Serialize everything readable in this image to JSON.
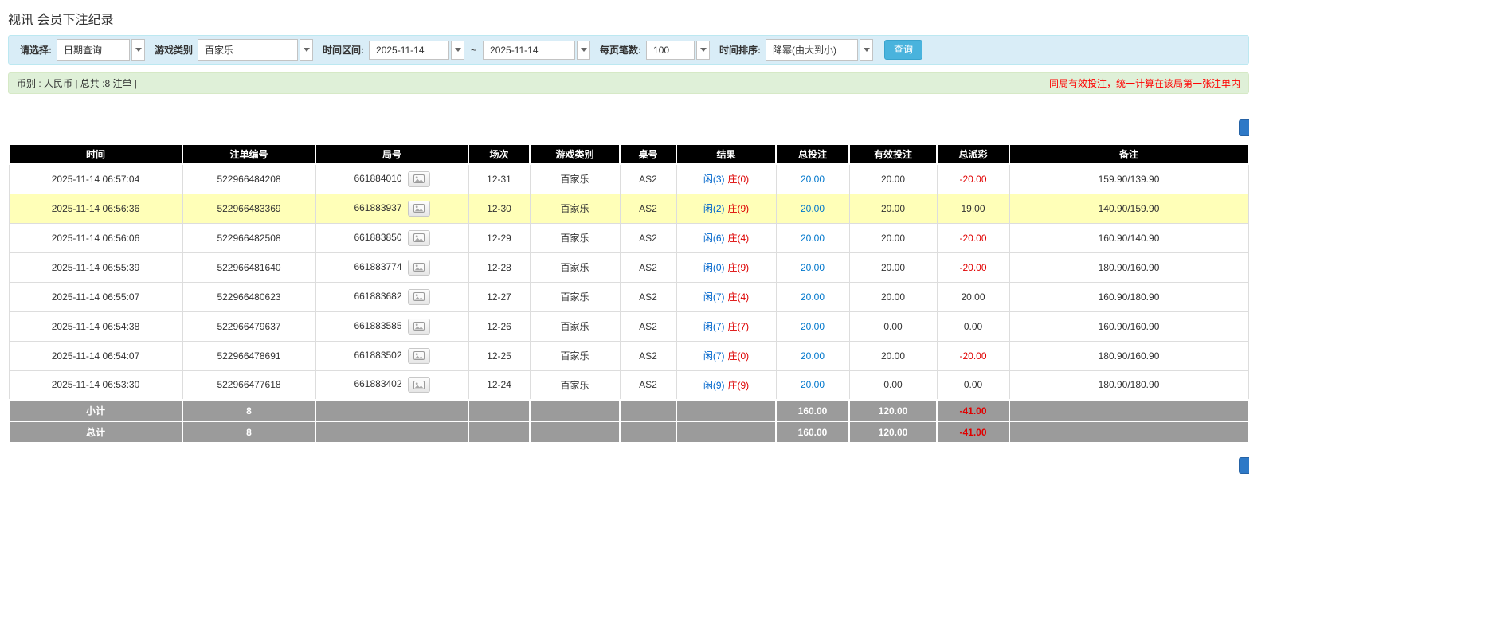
{
  "page": {
    "title": "视讯 会员下注纪录"
  },
  "filter_bar": {
    "select_label": "请选择:",
    "select_value": "日期查询",
    "game_type_label": "游戏类别",
    "game_type_value": "百家乐",
    "date_range_label": "时间区间:",
    "date_from": "2025-11-14",
    "date_separator": "~",
    "date_to": "2025-11-14",
    "page_size_label": "每页笔数:",
    "page_size_value": "100",
    "sort_label": "时间排序:",
    "sort_value": "降幂(由大到小)",
    "search_button_label": "查询"
  },
  "info_bar": {
    "summary": "币别 : 人民币 | 总共 :8 注单 |",
    "notice": "同局有效投注，统一计算在该局第一张注单内"
  },
  "table": {
    "headers": [
      "时间",
      "注单编号",
      "局号",
      "场次",
      "游戏类别",
      "桌号",
      "结果",
      "总投注",
      "有效投注",
      "总派彩",
      "备注"
    ],
    "rows": [
      {
        "time": "2025-11-14 06:57:04",
        "bet_id": "522966484208",
        "round_id": "661884010",
        "session": "12-31",
        "game": "百家乐",
        "table_no": "AS2",
        "result_player": "闲(3)",
        "result_banker": "庄(0)",
        "total_bet": "20.00",
        "valid_bet": "20.00",
        "payout": "-20.00",
        "note": "159.90/139.90",
        "highlight": false
      },
      {
        "time": "2025-11-14 06:56:36",
        "bet_id": "522966483369",
        "round_id": "661883937",
        "session": "12-30",
        "game": "百家乐",
        "table_no": "AS2",
        "result_player": "闲(2)",
        "result_banker": "庄(9)",
        "total_bet": "20.00",
        "valid_bet": "20.00",
        "payout": "19.00",
        "note": "140.90/159.90",
        "highlight": true
      },
      {
        "time": "2025-11-14 06:56:06",
        "bet_id": "522966482508",
        "round_id": "661883850",
        "session": "12-29",
        "game": "百家乐",
        "table_no": "AS2",
        "result_player": "闲(6)",
        "result_banker": "庄(4)",
        "total_bet": "20.00",
        "valid_bet": "20.00",
        "payout": "-20.00",
        "note": "160.90/140.90",
        "highlight": false
      },
      {
        "time": "2025-11-14 06:55:39",
        "bet_id": "522966481640",
        "round_id": "661883774",
        "session": "12-28",
        "game": "百家乐",
        "table_no": "AS2",
        "result_player": "闲(0)",
        "result_banker": "庄(9)",
        "total_bet": "20.00",
        "valid_bet": "20.00",
        "payout": "-20.00",
        "note": "180.90/160.90",
        "highlight": false
      },
      {
        "time": "2025-11-14 06:55:07",
        "bet_id": "522966480623",
        "round_id": "661883682",
        "session": "12-27",
        "game": "百家乐",
        "table_no": "AS2",
        "result_player": "闲(7)",
        "result_banker": "庄(4)",
        "total_bet": "20.00",
        "valid_bet": "20.00",
        "payout": "20.00",
        "note": "160.90/180.90",
        "highlight": false
      },
      {
        "time": "2025-11-14 06:54:38",
        "bet_id": "522966479637",
        "round_id": "661883585",
        "session": "12-26",
        "game": "百家乐",
        "table_no": "AS2",
        "result_player": "闲(7)",
        "result_banker": "庄(7)",
        "total_bet": "20.00",
        "valid_bet": "0.00",
        "payout": "0.00",
        "note": "160.90/160.90",
        "highlight": false
      },
      {
        "time": "2025-11-14 06:54:07",
        "bet_id": "522966478691",
        "round_id": "661883502",
        "session": "12-25",
        "game": "百家乐",
        "table_no": "AS2",
        "result_player": "闲(7)",
        "result_banker": "庄(0)",
        "total_bet": "20.00",
        "valid_bet": "20.00",
        "payout": "-20.00",
        "note": "180.90/160.90",
        "highlight": false
      },
      {
        "time": "2025-11-14 06:53:30",
        "bet_id": "522966477618",
        "round_id": "661883402",
        "session": "12-24",
        "game": "百家乐",
        "table_no": "AS2",
        "result_player": "闲(9)",
        "result_banker": "庄(9)",
        "total_bet": "20.00",
        "valid_bet": "0.00",
        "payout": "0.00",
        "note": "180.90/180.90",
        "highlight": false
      }
    ],
    "subtotal": {
      "label": "小计",
      "count": "8",
      "total_bet": "160.00",
      "valid_bet": "120.00",
      "payout": "-41.00"
    },
    "total": {
      "label": "总计",
      "count": "8",
      "total_bet": "160.00",
      "valid_bet": "120.00",
      "payout": "-41.00"
    }
  },
  "colors": {
    "player_blue": "#0066cc",
    "banker_red": "#dd0000",
    "negative_red": "#e00000",
    "highlight_row": "#ffffb8",
    "header_bg": "#000000",
    "footer_bg": "#9b9b9b"
  }
}
